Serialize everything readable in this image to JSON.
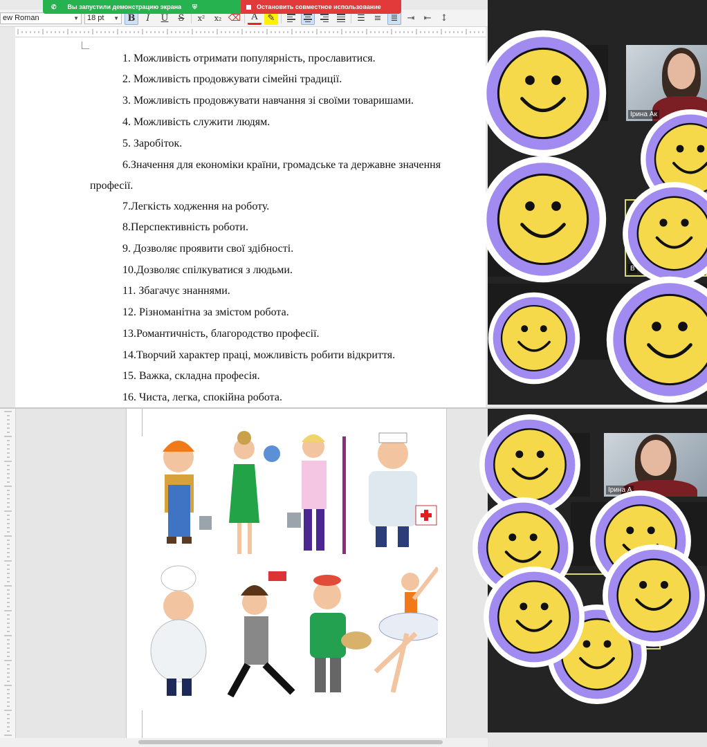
{
  "share_bar": {
    "sharing_text": "Вы запустили демонстрацию экрана",
    "stop_text": "Остановить совместное использование"
  },
  "toolbar": {
    "font_name": "ew Roman",
    "font_size": "18 pt",
    "bold": "B",
    "italic": "I",
    "underline": "U",
    "strike": "S",
    "superscript": "x²",
    "subscript": "x₂",
    "font_color": "A"
  },
  "document": {
    "lines": [
      "1. Можливість  отримати популярність, прославитися.",
      "2. Можливість продовжувати сімейні традиції.",
      "3. Можливість продовжувати навчання зі своїми товаришами.",
      "4. Можливість  служити людям.",
      "5. Заробіток.",
      "6.Значення для економіки країни, громадське та державне значення",
      "професії.",
      "7.Легкість  ходження на роботу.",
      "8.Перспективність роботи.",
      "9. Дозволяє проявити свої здібності.",
      "10.Дозволяє спілкуватися з людьми.",
      "11. Збагачує знаннями.",
      "12. Різноманітна за змістом робота.",
      "13.Романтичність, благородство професії.",
      "14.Творчий характер праці, можливість робити відкриття.",
      "15. Важка, складна професія.",
      "16. Чиста, легка, спокійна робота."
    ]
  },
  "gallery": {
    "top_participant_name": "Ірина Ак",
    "top_second_label": "В",
    "bottom_participant_name": "Ірина А"
  },
  "colors": {
    "smiley_face": "#f6d94a",
    "smiley_ring": "#a28bf0",
    "share_green": "#26b34f",
    "share_red": "#e23a3a"
  },
  "icons": {
    "phone": "phone-icon",
    "shield": "shield-icon",
    "stop": "stop-icon"
  }
}
